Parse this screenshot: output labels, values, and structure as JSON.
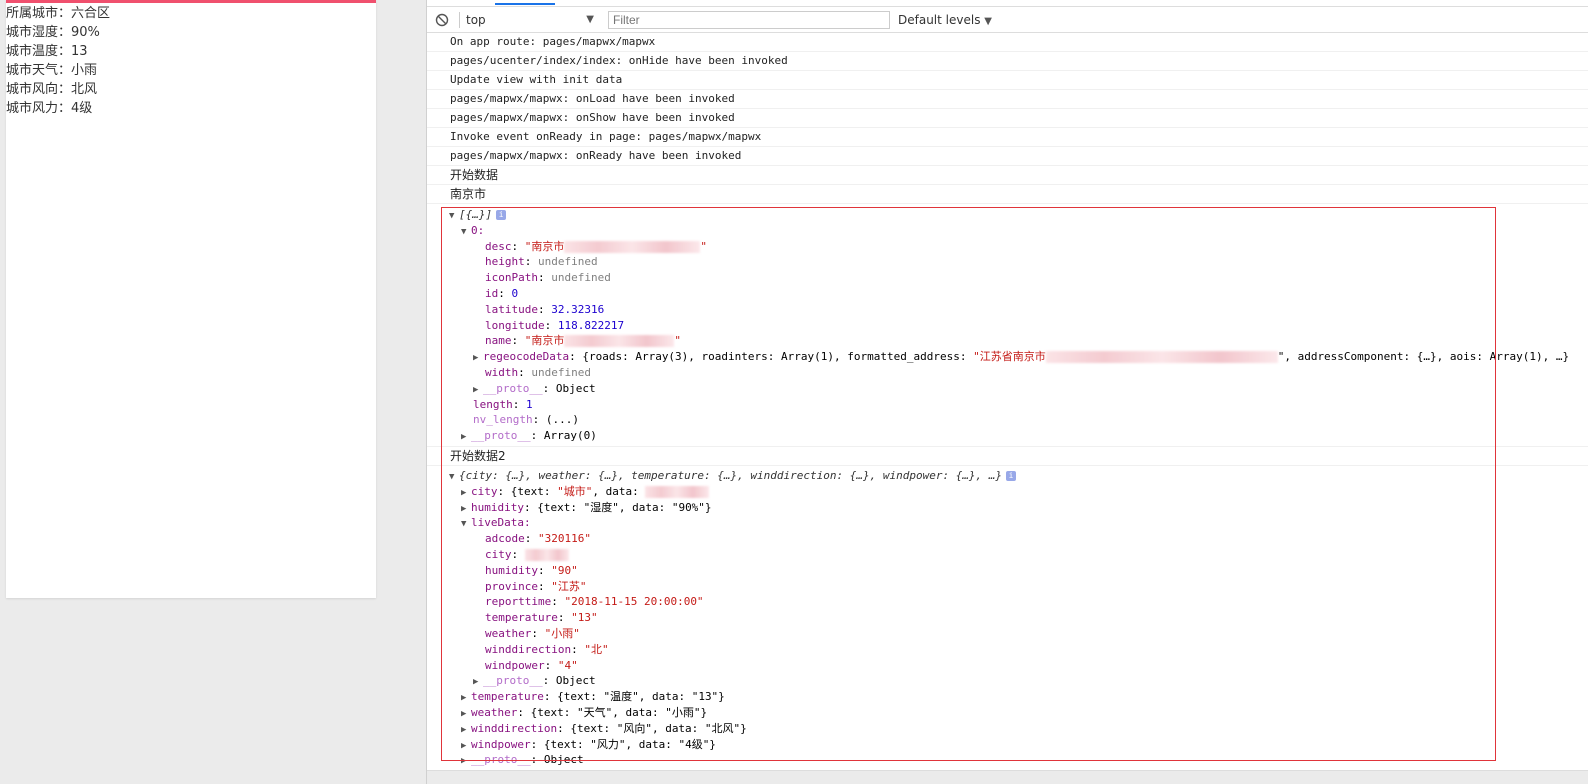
{
  "simulator": {
    "lines": [
      "所属城市：六合区",
      "城市湿度：90%",
      "城市温度：13",
      "城市天气：小雨",
      "城市风向：北风",
      "城市风力：4级"
    ]
  },
  "toolbar": {
    "context": "top",
    "filter_placeholder": "Filter",
    "levels": "Default levels"
  },
  "logs": [
    "On app route: pages/mapwx/mapwx",
    "pages/ucenter/index/index: onHide have been invoked",
    "Update view with init data",
    "pages/mapwx/mapwx: onLoad have been invoked",
    "pages/mapwx/mapwx: onShow have been invoked",
    "Invoke event onReady in page: pages/mapwx/mapwx",
    "pages/mapwx/mapwx: onReady have been invoked",
    "开始数据",
    "南京市"
  ],
  "tree1": {
    "summary": "[{…}]",
    "idx": "0:",
    "desc_k": "desc",
    "desc_v": "\"南京市",
    "height_k": "height",
    "height_v": "undefined",
    "iconPath_k": "iconPath",
    "iconPath_v": "undefined",
    "id_k": "id",
    "id_v": "0",
    "lat_k": "latitude",
    "lat_v": "32.32316",
    "lng_k": "longitude",
    "lng_v": "118.822217",
    "name_k": "name",
    "name_v": "\"南京市",
    "regeo_k": "regeocodeData",
    "regeo_v1": "{roads: Array(3), roadinters: Array(1), formatted_address: ",
    "regeo_v2": "\"江苏省南京市",
    "regeo_v3": "\", addressComponent: {…}, aois: Array(1), …}",
    "width_k": "width",
    "width_v": "undefined",
    "proto_k": "__proto__",
    "proto_v": "Object",
    "len_k": "length",
    "len_v": "1",
    "nvlen_k": "nv_length",
    "nvlen_v": "(...)",
    "aproto_k": "__proto__",
    "aproto_v": "Array(0)"
  },
  "log2": "开始数据2",
  "tree2": {
    "summary": "{city: {…}, weather: {…}, temperature: {…}, winddirection: {…}, windpower: {…}, …}",
    "city_k": "city",
    "city_v1": "{text: ",
    "city_v2": "\"城市\"",
    "city_v3": ", data: ",
    "hum_k": "humidity",
    "hum_v": "{text: \"湿度\", data: \"90%\"}",
    "live_k": "liveData:",
    "adcode_k": "adcode",
    "adcode_v": "\"320116\"",
    "lcity_k": "city",
    "lhum_k": "humidity",
    "lhum_v": "\"90\"",
    "prov_k": "province",
    "prov_v": "\"江苏\"",
    "rt_k": "reporttime",
    "rt_v": "\"2018-11-15 20:00:00\"",
    "temp_k": "temperature",
    "temp_v": "\"13\"",
    "wea_k": "weather",
    "wea_v": "\"小雨\"",
    "wd_k": "winddirection",
    "wd_v": "\"北\"",
    "wp_k": "windpower",
    "wp_v": "\"4\"",
    "lproto_k": "__proto__",
    "lproto_v": "Object",
    "t_k": "temperature",
    "t_v": "{text: \"温度\", data: \"13\"}",
    "w_k": "weather",
    "w_v": "{text: \"天气\", data: \"小雨\"}",
    "d_k": "winddirection",
    "d_v": "{text: \"风向\", data: \"北风\"}",
    "p_k": "windpower",
    "p_v": "{text: \"风力\", data: \"4级\"}",
    "oproto_k": "__proto__",
    "oproto_v": "Object"
  }
}
